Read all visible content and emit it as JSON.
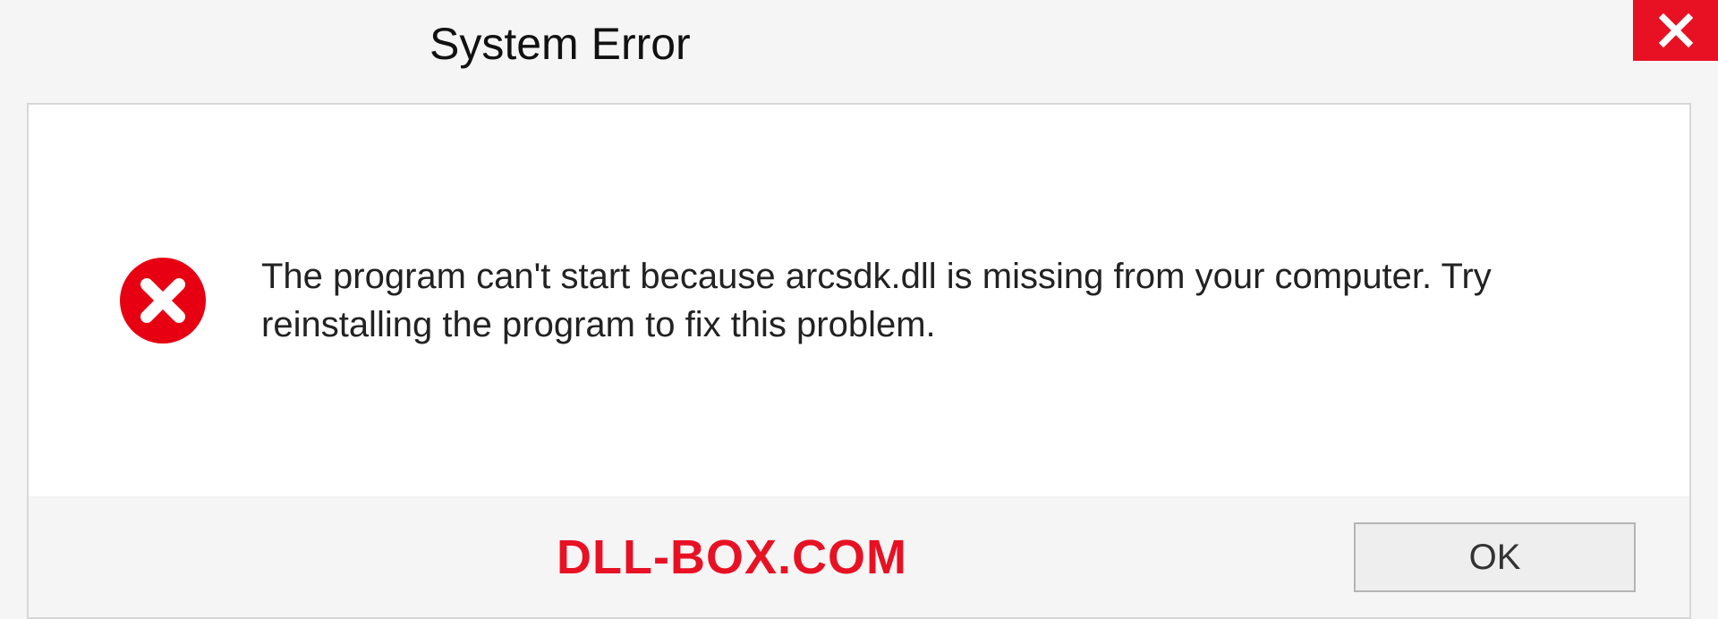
{
  "dialog": {
    "title": "System Error",
    "message": "The program can't start because arcsdk.dll is missing from your computer. Try reinstalling the program to fix this problem.",
    "ok_label": "OK"
  },
  "watermark": "DLL-BOX.COM",
  "colors": {
    "error_red": "#e81123",
    "close_red": "#e81123"
  },
  "icons": {
    "close": "close-icon",
    "error": "error-circle-x-icon"
  }
}
